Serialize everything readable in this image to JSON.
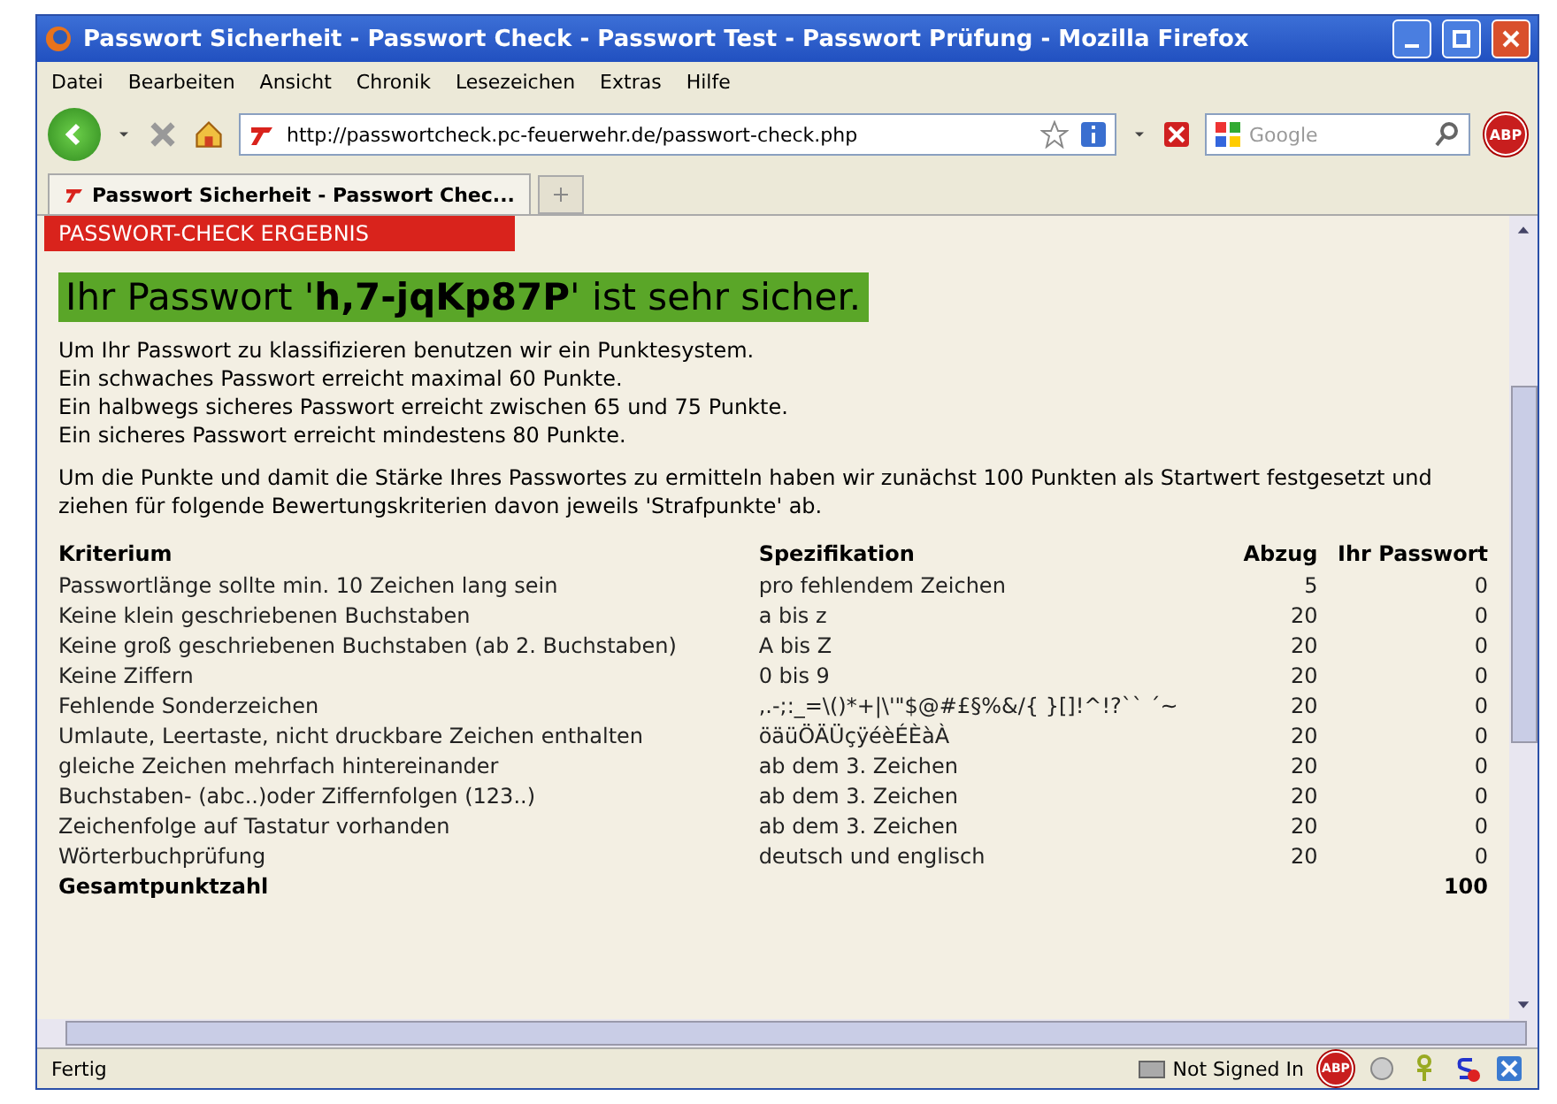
{
  "window": {
    "title": "Passwort Sicherheit - Passwort Check - Passwort Test - Passwort Prüfung - Mozilla Firefox"
  },
  "menu": [
    "Datei",
    "Bearbeiten",
    "Ansicht",
    "Chronik",
    "Lesezeichen",
    "Extras",
    "Hilfe"
  ],
  "toolbar": {
    "url": "http://passwortcheck.pc-feuerwehr.de/passwort-check.php",
    "search_placeholder": "Google",
    "abp_label": "ABP"
  },
  "tabs": [
    {
      "label": "Passwort Sicherheit - Passwort Chec...",
      "selected": true
    }
  ],
  "page": {
    "banner": "PASSWORT-CHECK ERGEBNIS",
    "result": "Ihr Passwort '**h,7-jqKp87P**' ist sehr sicher.",
    "intro": [
      "Um Ihr Passwort zu klassifizieren benutzen wir ein Punktesystem.",
      "Ein schwaches Passwort erreicht maximal 60 Punkte.",
      "Ein halbwegs sicheres Passwort erreicht zwischen 65 und 75 Punkte.",
      "Ein sicheres Passwort erreicht mindestens 80 Punkte."
    ],
    "explanation": "Um die Punkte und damit die Stärke Ihres Passwortes zu ermitteln haben wir zunächst 100 Punkten als Startwert festgesetzt und ziehen für folgende Bewertungskriterien davon jeweils 'Strafpunkte' ab.",
    "table": {
      "columns": [
        "Kriterium",
        "Spezifikation",
        "Abzug",
        "Ihr Passwort"
      ],
      "rows": [
        [
          "Passwortlänge sollte min. 10 Zeichen lang sein",
          "pro fehlendem Zeichen",
          "5",
          "0"
        ],
        [
          "Keine klein geschriebenen Buchstaben",
          "a bis z",
          "20",
          "0"
        ],
        [
          "Keine groß geschriebenen Buchstaben (ab 2. Buchstaben)",
          "A bis Z",
          "20",
          "0"
        ],
        [
          "Keine Ziffern",
          "0 bis 9",
          "20",
          "0"
        ],
        [
          "Fehlende Sonderzeichen",
          ",.-;:_=\\()*+|\\'\"$@#£§%&/{ }[]!^!?`` ´~",
          "20",
          "0"
        ],
        [
          "Umlaute, Leertaste, nicht druckbare Zeichen enthalten",
          "öäüÖÄÜçÿéèÉÈàÀ",
          "20",
          "0"
        ],
        [
          "gleiche Zeichen mehrfach hintereinander",
          "ab dem 3. Zeichen",
          "20",
          "0"
        ],
        [
          "Buchstaben- (abc..)oder Ziffernfolgen (123..)",
          "ab dem 3. Zeichen",
          "20",
          "0"
        ],
        [
          "Zeichenfolge auf Tastatur vorhanden",
          "ab dem 3. Zeichen",
          "20",
          "0"
        ],
        [
          "Wörterbuchprüfung",
          "deutsch und englisch",
          "20",
          "0"
        ]
      ],
      "total": {
        "label": "Gesamtpunktzahl",
        "value": "100"
      }
    }
  },
  "status_bar": {
    "text": "Fertig",
    "signin": "Not Signed In",
    "abp_label": "ABP"
  }
}
